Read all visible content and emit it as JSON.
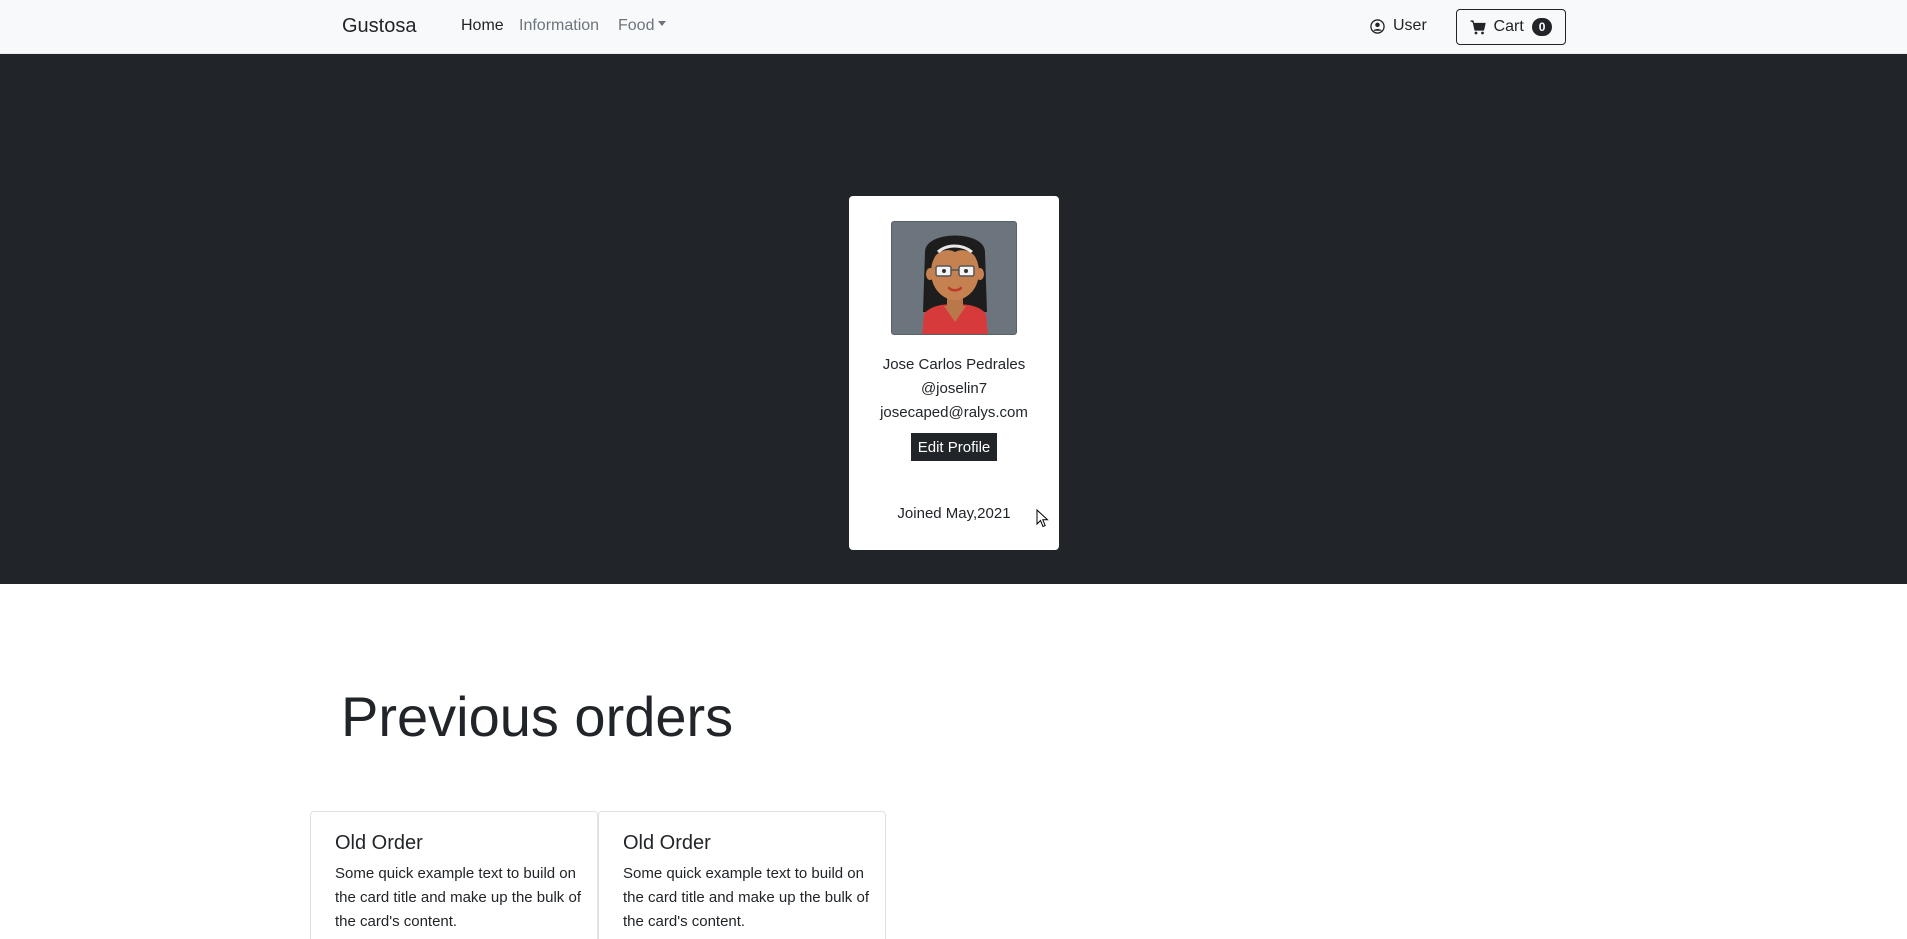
{
  "navbar": {
    "brand": "Gustosa",
    "links": [
      "Home",
      "Information",
      "Food"
    ],
    "user_label": "User",
    "cart_label": "Cart",
    "cart_count": "0"
  },
  "profile": {
    "name": "Jose Carlos Pedrales",
    "handle": "@joselin7",
    "email": "josecaped@ralys.com",
    "edit_label": "Edit Profile",
    "joined": "Joined May,2021"
  },
  "orders": {
    "title": "Previous orders",
    "cards": [
      {
        "title": "Old Order",
        "text": "Some quick example text to build on the card title and make up the bulk of the card's content."
      },
      {
        "title": "Old Order",
        "text": "Some quick example text to build on the card title and make up the bulk of the card's content."
      }
    ]
  },
  "colors": {
    "hero_bg": "#212529",
    "navbar_bg": "#f8f9fa",
    "avatar_bg": "#6c757d"
  }
}
